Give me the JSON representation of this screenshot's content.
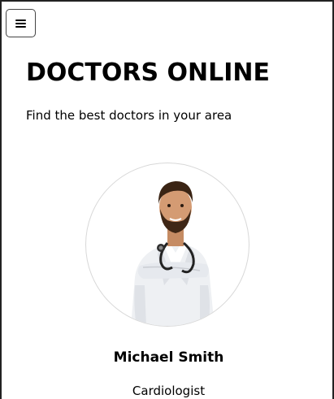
{
  "header": {
    "menu_icon": "hamburger-menu-icon",
    "title": "DOCTORS ONLINE",
    "subtitle": "Find the best doctors in your area"
  },
  "doctor": {
    "name": "Michael Smith",
    "specialty": "Cardiologist",
    "photo": "doctor-portrait"
  },
  "colors": {
    "background": "#ffffff",
    "text": "#000000",
    "avatar_border": "#d8d8d8"
  }
}
